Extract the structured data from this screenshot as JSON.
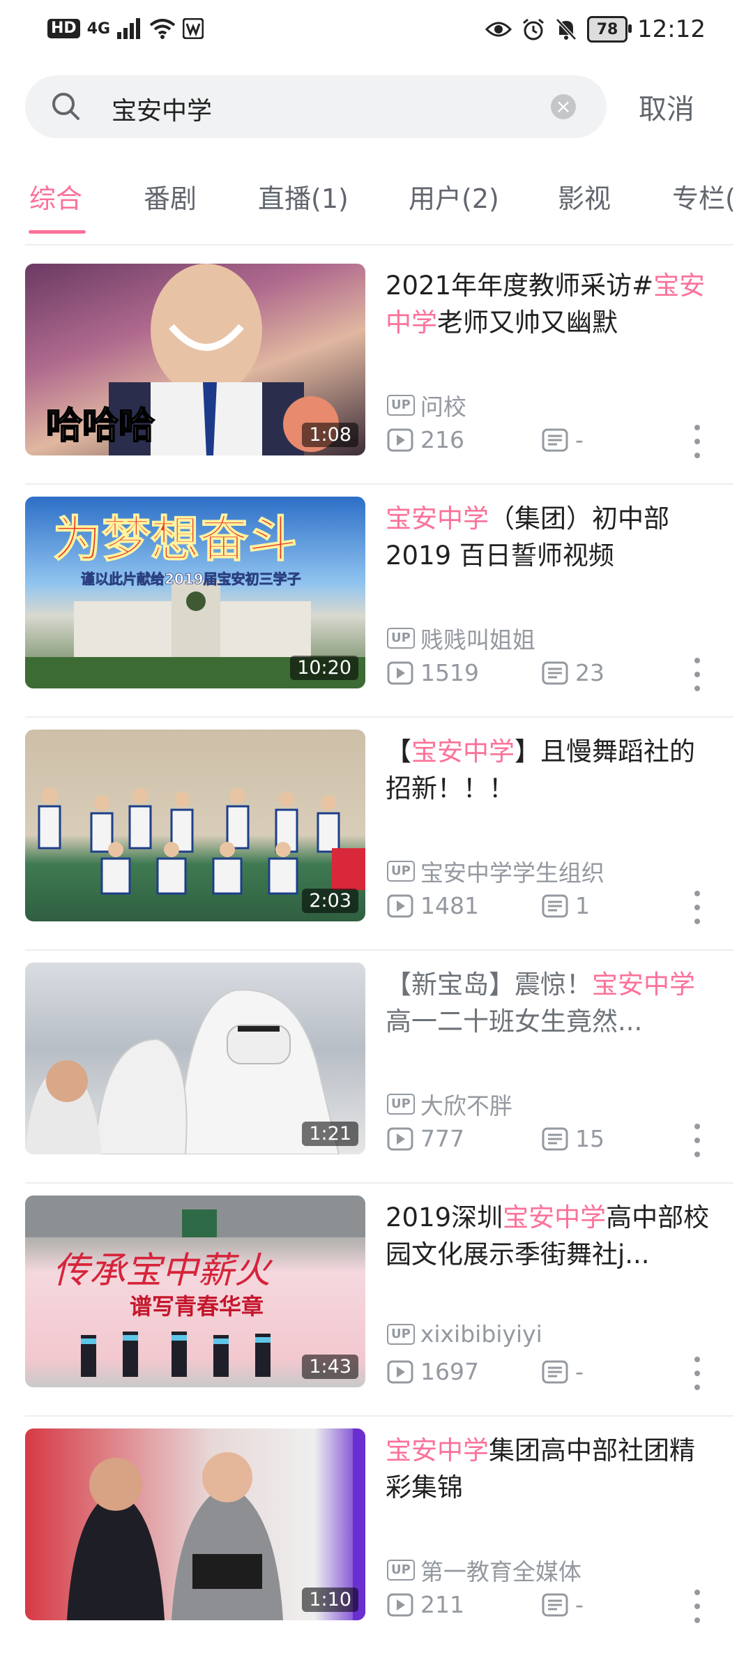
{
  "status_bar": {
    "hd": "HD",
    "network": "4G",
    "battery": "78",
    "time": "12:12"
  },
  "search": {
    "query": "宝安中学",
    "cancel_label": "取消"
  },
  "tabs": [
    {
      "label": "综合",
      "active": true
    },
    {
      "label": "番剧"
    },
    {
      "label": "直播(1)"
    },
    {
      "label": "用户(2)"
    },
    {
      "label": "影视"
    },
    {
      "label": "专栏("
    }
  ],
  "highlight_color": "#fb7299",
  "results": [
    {
      "title_parts": [
        {
          "t": "2021年年度教师采访#"
        },
        {
          "t": "宝安中学",
          "hl": true
        },
        {
          "t": "老师又帅又幽默"
        }
      ],
      "uploader": "问校",
      "plays": "216",
      "comments": "-",
      "duration": "1:08"
    },
    {
      "title_parts": [
        {
          "t": "宝安中学",
          "hl": true
        },
        {
          "t": "（集团）初中部2019 百日誓师视频"
        }
      ],
      "uploader": "贱贱叫姐姐",
      "plays": "1519",
      "comments": "23",
      "duration": "10:20"
    },
    {
      "title_parts": [
        {
          "t": "【"
        },
        {
          "t": "宝安中学",
          "hl": true
        },
        {
          "t": "】且慢舞蹈社的招新！！！"
        }
      ],
      "uploader": "宝安中学学生组织",
      "plays": "1481",
      "comments": "1",
      "duration": "2:03"
    },
    {
      "title_parts": [
        {
          "t": "【新宝岛】震惊！"
        },
        {
          "t": "宝安中学",
          "hl": true
        },
        {
          "t": "高一二十班女生竟然..."
        }
      ],
      "watched": true,
      "uploader": "大欣不胖",
      "plays": "777",
      "comments": "15",
      "duration": "1:21"
    },
    {
      "title_parts": [
        {
          "t": "2019深圳"
        },
        {
          "t": "宝安中学",
          "hl": true
        },
        {
          "t": "高中部校园文化展示季街舞社j..."
        }
      ],
      "uploader": "xixibibiyiyi",
      "plays": "1697",
      "comments": "-",
      "duration": "1:43"
    },
    {
      "title_parts": [
        {
          "t": "宝安中学",
          "hl": true
        },
        {
          "t": "集团高中部社团精彩集锦"
        }
      ],
      "uploader": "第一教育全媒体",
      "plays": "211",
      "comments": "-",
      "duration": "1:10"
    }
  ],
  "thumb_labels": {
    "t2_text": "为梦想奋斗",
    "t2_sub": "谨以此片献给2019届宝安初三学子",
    "t5_text": "传承宝中薪火",
    "t5_sub": "谱写青春华章",
    "t1_text": "哈哈哈"
  }
}
